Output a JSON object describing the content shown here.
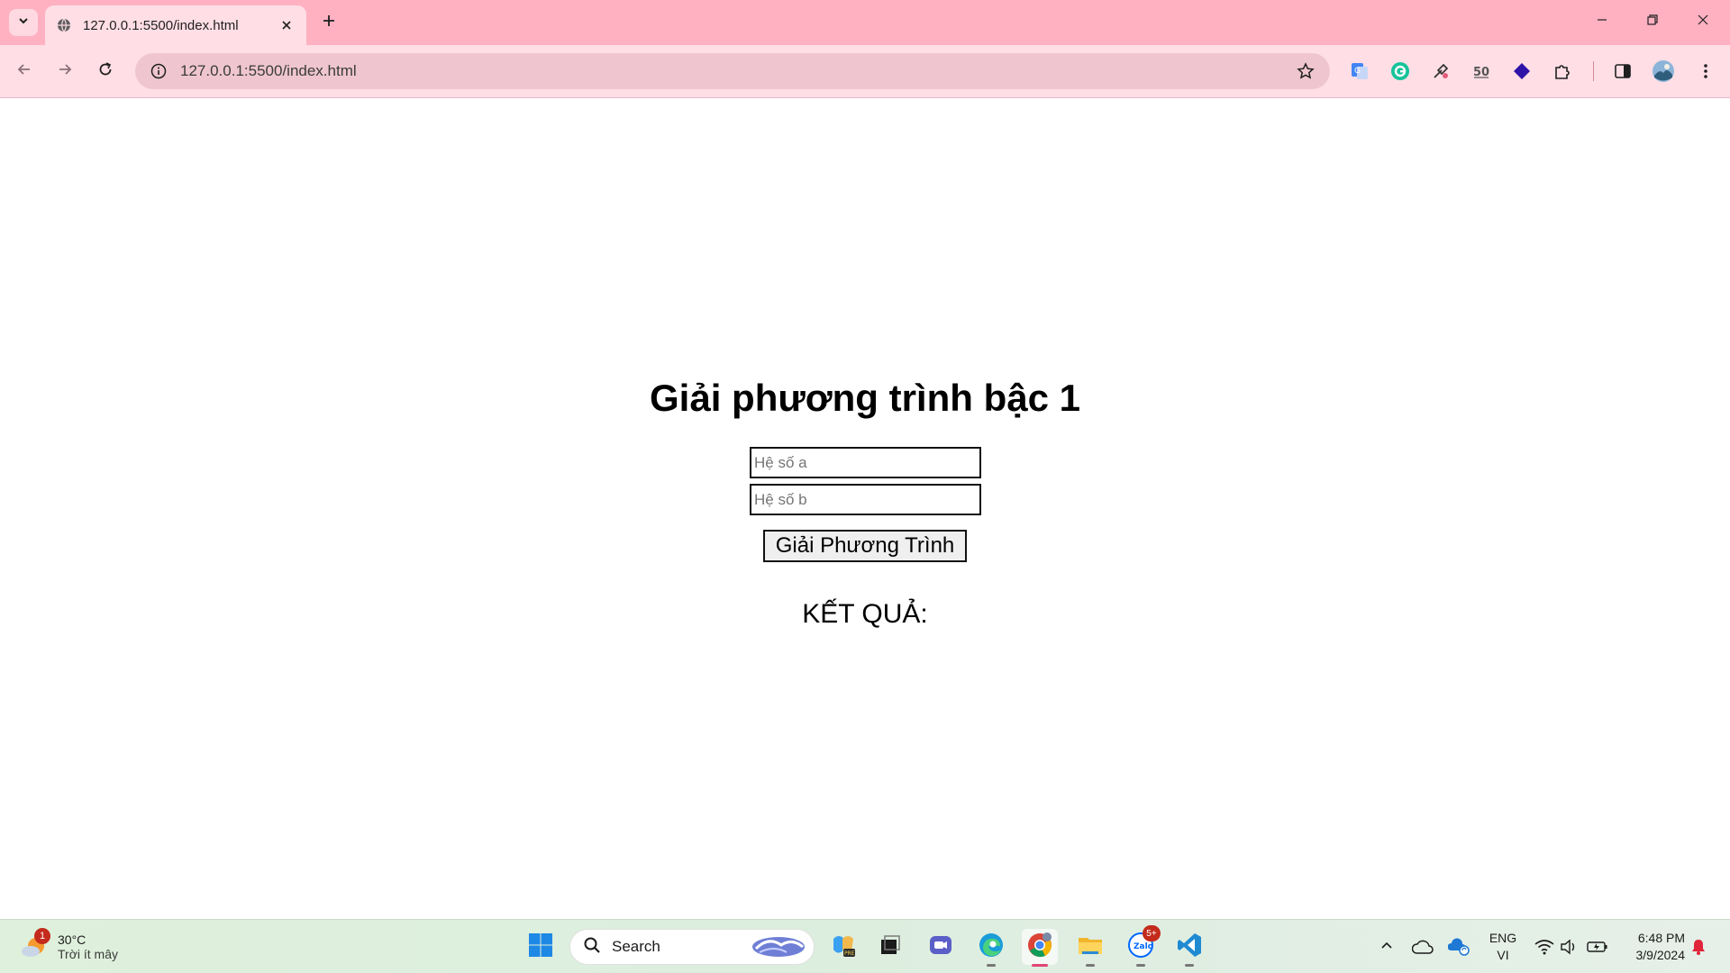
{
  "browser": {
    "tab_title": "127.0.0.1:5500/index.html",
    "url": "127.0.0.1:5500/index.html",
    "accent_color": "#ffb1c2",
    "extensions": [
      "translate-icon",
      "grammarly-icon",
      "eyedropper-icon",
      "extension-icon",
      "diamond-extension-icon",
      "puzzle-icon"
    ]
  },
  "page": {
    "title": "Giải phương trình bậc 1",
    "input_a_placeholder": "Hệ số a",
    "input_b_placeholder": "Hệ số b",
    "solve_button": "Giải Phương Trình",
    "result_label": "KẾT QUẢ:"
  },
  "taskbar": {
    "weather_temp": "30°C",
    "weather_desc": "Trời ít mây",
    "weather_badge": "1",
    "search_placeholder": "Search",
    "zalo_badge": "5+",
    "lang_primary": "ENG",
    "lang_secondary": "VI",
    "time": "6:48 PM",
    "date": "3/9/2024"
  }
}
